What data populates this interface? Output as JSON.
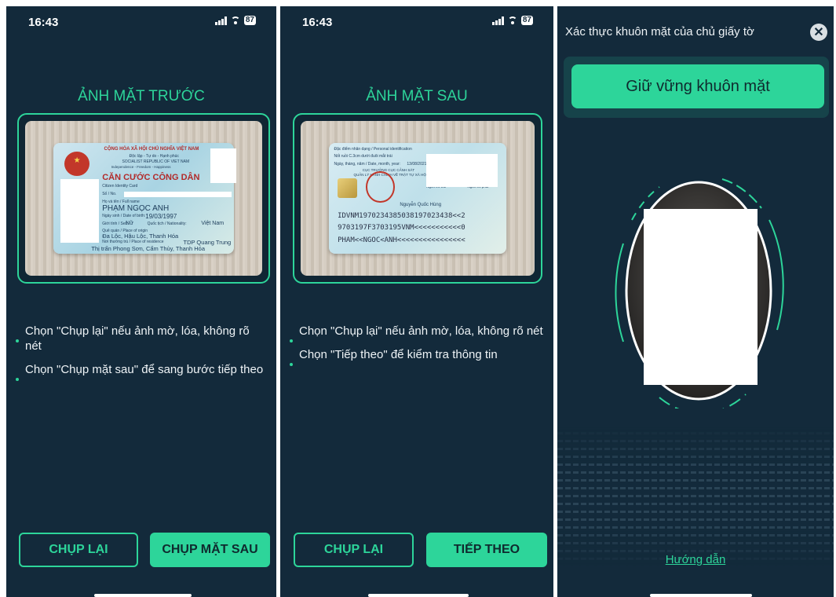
{
  "colors": {
    "background": "#132a3b",
    "accent": "#2dd59a"
  },
  "screen1": {
    "time": "16:43",
    "battery": "87",
    "title": "ẢNH MẶT TRƯỚC",
    "card": {
      "country": "CỘNG HÒA XÃ HỘI CHỦ NGHĨA VIỆT NAM",
      "motto": "Độc lập - Tự do - Hạnh phúc",
      "country_en": "SOCIALIST REPUBLIC OF VIET NAM",
      "motto_en": "Independence - Freedom - Happiness",
      "heading": "CĂN CƯỚC CÔNG DÂN",
      "heading_en": "Citizen Identity Card",
      "number_label": "Số / No.",
      "name_label": "Họ và tên / Full name",
      "name": "PHẠM NGỌC ANH",
      "dob_label": "Ngày sinh / Date of birth:",
      "dob": "19/03/1997",
      "sex_label": "Giới tính / Sex:",
      "sex": "Nữ",
      "nationality_label": "Quốc tịch / Nationality:",
      "nationality": "Việt Nam",
      "origin_label": "Quê quán / Place of origin",
      "origin": "Đa Lộc, Hậu Lộc, Thanh Hóa",
      "residence_label": "Nơi thường trú / Place of residence",
      "residence_1": "TDP Quang Trung",
      "residence_2": "Thị trấn Phong Sơn, Cẩm Thủy, Thanh Hóa"
    },
    "tips": [
      "Chọn \"Chụp lại\" nếu ảnh mờ, lóa, không rõ nét",
      "Chọn \"Chụp mặt sau\" để sang bước tiếp theo"
    ],
    "retake_label": "CHỤP LẠI",
    "next_label": "CHỤP MẶT SAU"
  },
  "screen2": {
    "time": "16:43",
    "battery": "87",
    "title": "ẢNH MẶT SAU",
    "card": {
      "features_label": "Đặc điểm nhân dạng / Personal identification",
      "features": "Nốt ruồi C.3cm dưới đuôi mắt trái",
      "date_label": "Ngày, tháng, năm / Date, month, year:",
      "date": "13/08/2021",
      "authority_1": "CỤC TRƯỞNG CỤC CẢNH SÁT",
      "authority_2": "QUẢN LÝ HÀNH CHÍNH VỀ TRẬT TỰ XÃ HỘI",
      "signer": "Nguyễn Quốc Hùng",
      "left_finger": "Ngón trỏ trái",
      "right_finger": "Ngón trỏ phải",
      "mrz_1": "IDVNM1970234385038197023438<<2",
      "mrz_2": "9703197F3703195VNM<<<<<<<<<<<0",
      "mrz_3": "PHAM<<NGOC<ANH<<<<<<<<<<<<<<<<"
    },
    "tips": [
      "Chọn \"Chụp lại\" nếu ảnh mờ, lóa, không rõ nét",
      "Chọn \"Tiếp theo\" để kiểm tra thông tin"
    ],
    "retake_label": "CHỤP LẠI",
    "next_label": "TIẾP THEO"
  },
  "screen3": {
    "title": "Xác thực khuôn mặt của chủ giấy tờ",
    "close_icon": "close-icon",
    "banner": "Giữ vững khuôn mặt",
    "guide_link": "Hướng dẫn"
  }
}
